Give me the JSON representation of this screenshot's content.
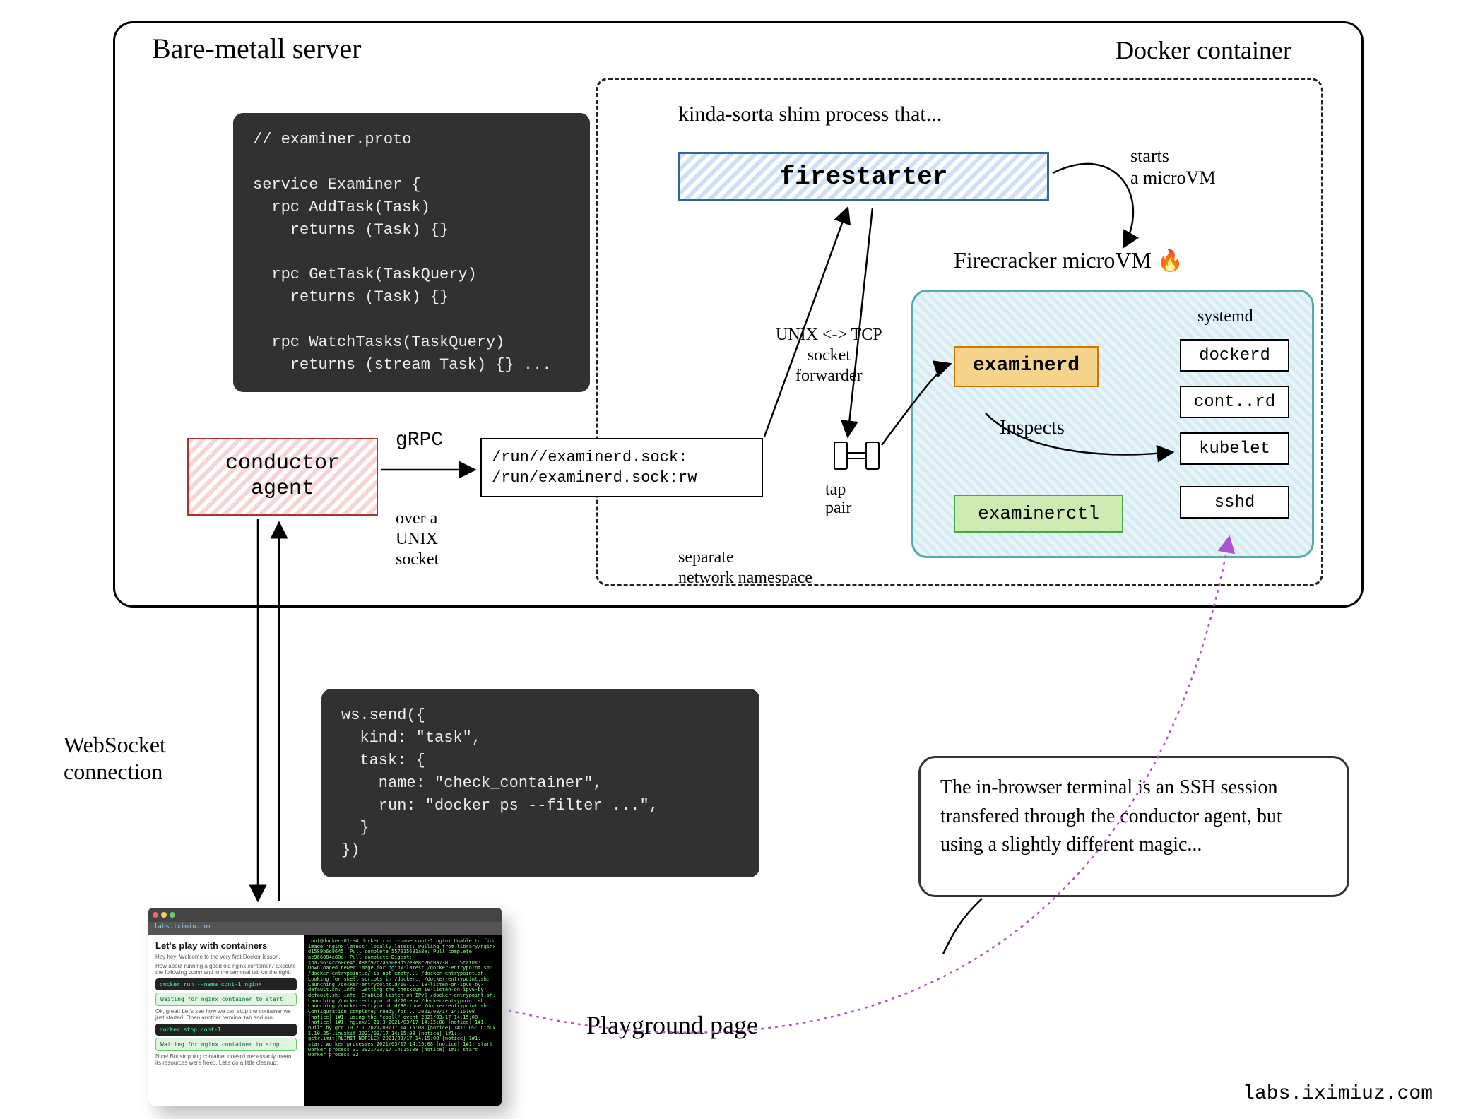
{
  "titles": {
    "server": "Bare-metall server",
    "docker": "Docker container",
    "kinda": "kinda-sorta shim process that...",
    "fc": "Firecracker microVM",
    "playground": "Playground page"
  },
  "labels": {
    "grpc": "gRPC",
    "over_unix": "over a\nUNIX\nsocket",
    "socket_fwd": "UNIX <-> TCP\nsocket\nforwarder",
    "sep_ns": "separate\nnetwork namespace",
    "starts": "starts\na microVM",
    "tap": "tap\npair",
    "systemd": "systemd",
    "inspects": "Inspects",
    "ws": "WebSocket\nconnection"
  },
  "boxes": {
    "conductor": "conductor\nagent",
    "sockpath": "/run/<vm>/examinerd.sock:\n/run/examinerd.sock:rw",
    "firestarter": "firestarter",
    "examinerd": "examinerd",
    "examinerctl": "examinerctl"
  },
  "services": [
    "dockerd",
    "cont..rd",
    "kubelet",
    "sshd"
  ],
  "code": {
    "proto": "// examiner.proto\n\nservice Examiner {\n  rpc AddTask(Task)\n    returns (Task) {}\n\n  rpc GetTask(TaskQuery)\n    returns (Task) {}\n\n  rpc WatchTasks(TaskQuery)\n    returns (stream Task) {} ...",
    "ws": "ws.send({\n  kind: \"task\",\n  task: {\n    name: \"check_container\",\n    run: \"docker ps --filter ...\",\n  }\n})"
  },
  "callout": "The in-browser terminal is an SSH session transfered through the conductor agent, but using a slightly different magic...",
  "browser": {
    "url": "labs.iximiu.com",
    "title": "Let's play with containers",
    "sub1": "Hey hey! Welcome to the very first Docker lesson.",
    "sub2": "How about running a good old nginx container? Execute the following command in the terminal tab on the right:",
    "cmd1": "docker run --name cont-1 nginx",
    "wait1": "Waiting for nginx container to start",
    "sub3": "Ok, great! Let's see how we can stop the container we just started. Open another terminal tab and run:",
    "cmd2": "docker stop cont-1",
    "wait2": "Waiting for nginx container to stop...",
    "sub4": "Nice! But stopping container doesn't necessarily mean its resources were freed. Let's do a little cleanup:",
    "term": "root@docker-01:~# docker run --name cont-1 nginx\nUnable to find image 'nginx:latest' locally\nlatest: Pulling from library/nginx\nd1589b6d8645: Pull complete\n557915691a8e: Pull complete\nac966084e80a: Pull complete\nDigest: sha256:4cc60ce451d8ef92c2a550e8d52e0e8c26c0a730...\nStatus: Downloaded newer image for nginx:latest\n/docker-entrypoint.sh: /docker-entrypoint.d/ is not empty...\n/docker-entrypoint.sh: Looking for shell scripts in /docker..\n/docker-entrypoint.sh: Launching /docker-entrypoint.d/10-...\n10-listen-on-ipv6-by-default.sh: info: Getting the checksum\n10-listen-on-ipv6-by-default.sh: info: Enabled listen on IPv6\n/docker-entrypoint.sh: Launching /docker-entrypoint.d/20-env\n/docker-entrypoint.sh: Launching /docker-entrypoint.d/30-tune\n/docker-entrypoint.sh: Configuration complete; ready for...\n2021/03/17 14:15:08 [notice] 1#1: using the \"epoll\" event\n2021/03/17 14:15:08 [notice] 1#1: nginx/1.21.3\n2021/03/17 14:15:08 [notice] 1#1: built by gcc 10.2.1\n2021/03/17 14:15:08 [notice] 1#1: OS: Linux 5.10.25-linuxkit\n2021/03/17 14:15:08 [notice] 1#1: getrlimit(RLIMIT_NOFILE)\n2021/03/17 14:15:08 [notice] 1#1: start worker processes\n2021/03/17 14:15:08 [notice] 1#1: start worker process 31\n2021/03/17 14:15:08 [notice] 1#1: start worker process 32"
  },
  "footer": "labs.iximiuz.com"
}
